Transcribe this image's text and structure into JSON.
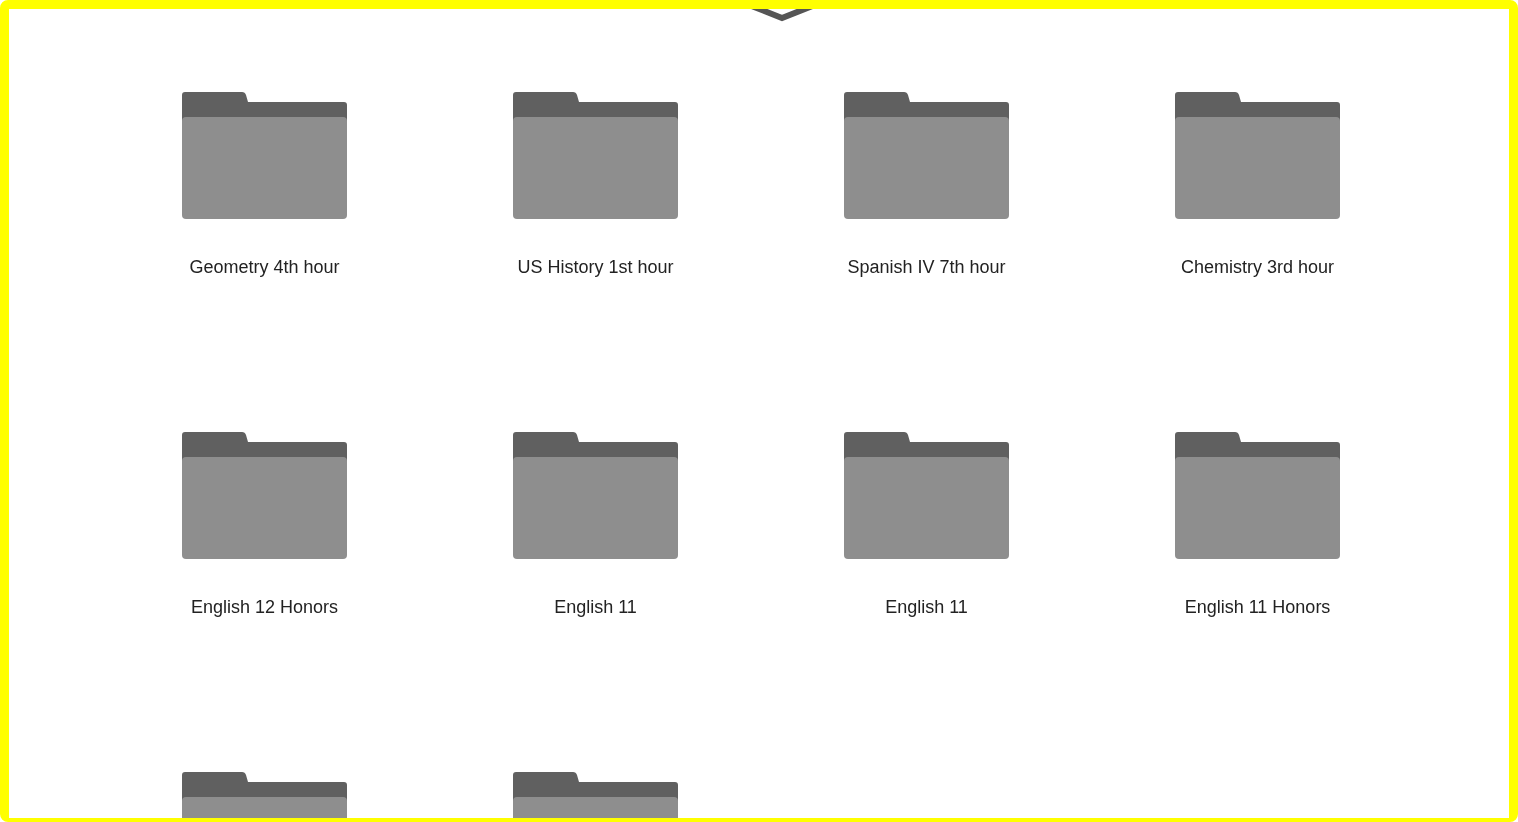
{
  "folders": [
    {
      "kind": "folder",
      "label": "Geometry 4th hour"
    },
    {
      "kind": "folder",
      "label": "US History 1st hour"
    },
    {
      "kind": "folder",
      "label": "Spanish IV 7th hour"
    },
    {
      "kind": "folder",
      "label": "Chemistry 3rd hour"
    },
    {
      "kind": "folder",
      "label": "English 12 Honors"
    },
    {
      "kind": "folder",
      "label": "English 11"
    },
    {
      "kind": "folder",
      "label": "English 11"
    },
    {
      "kind": "folder",
      "label": "English 11 Honors"
    },
    {
      "kind": "folder"
    },
    {
      "kind": "folder"
    }
  ]
}
